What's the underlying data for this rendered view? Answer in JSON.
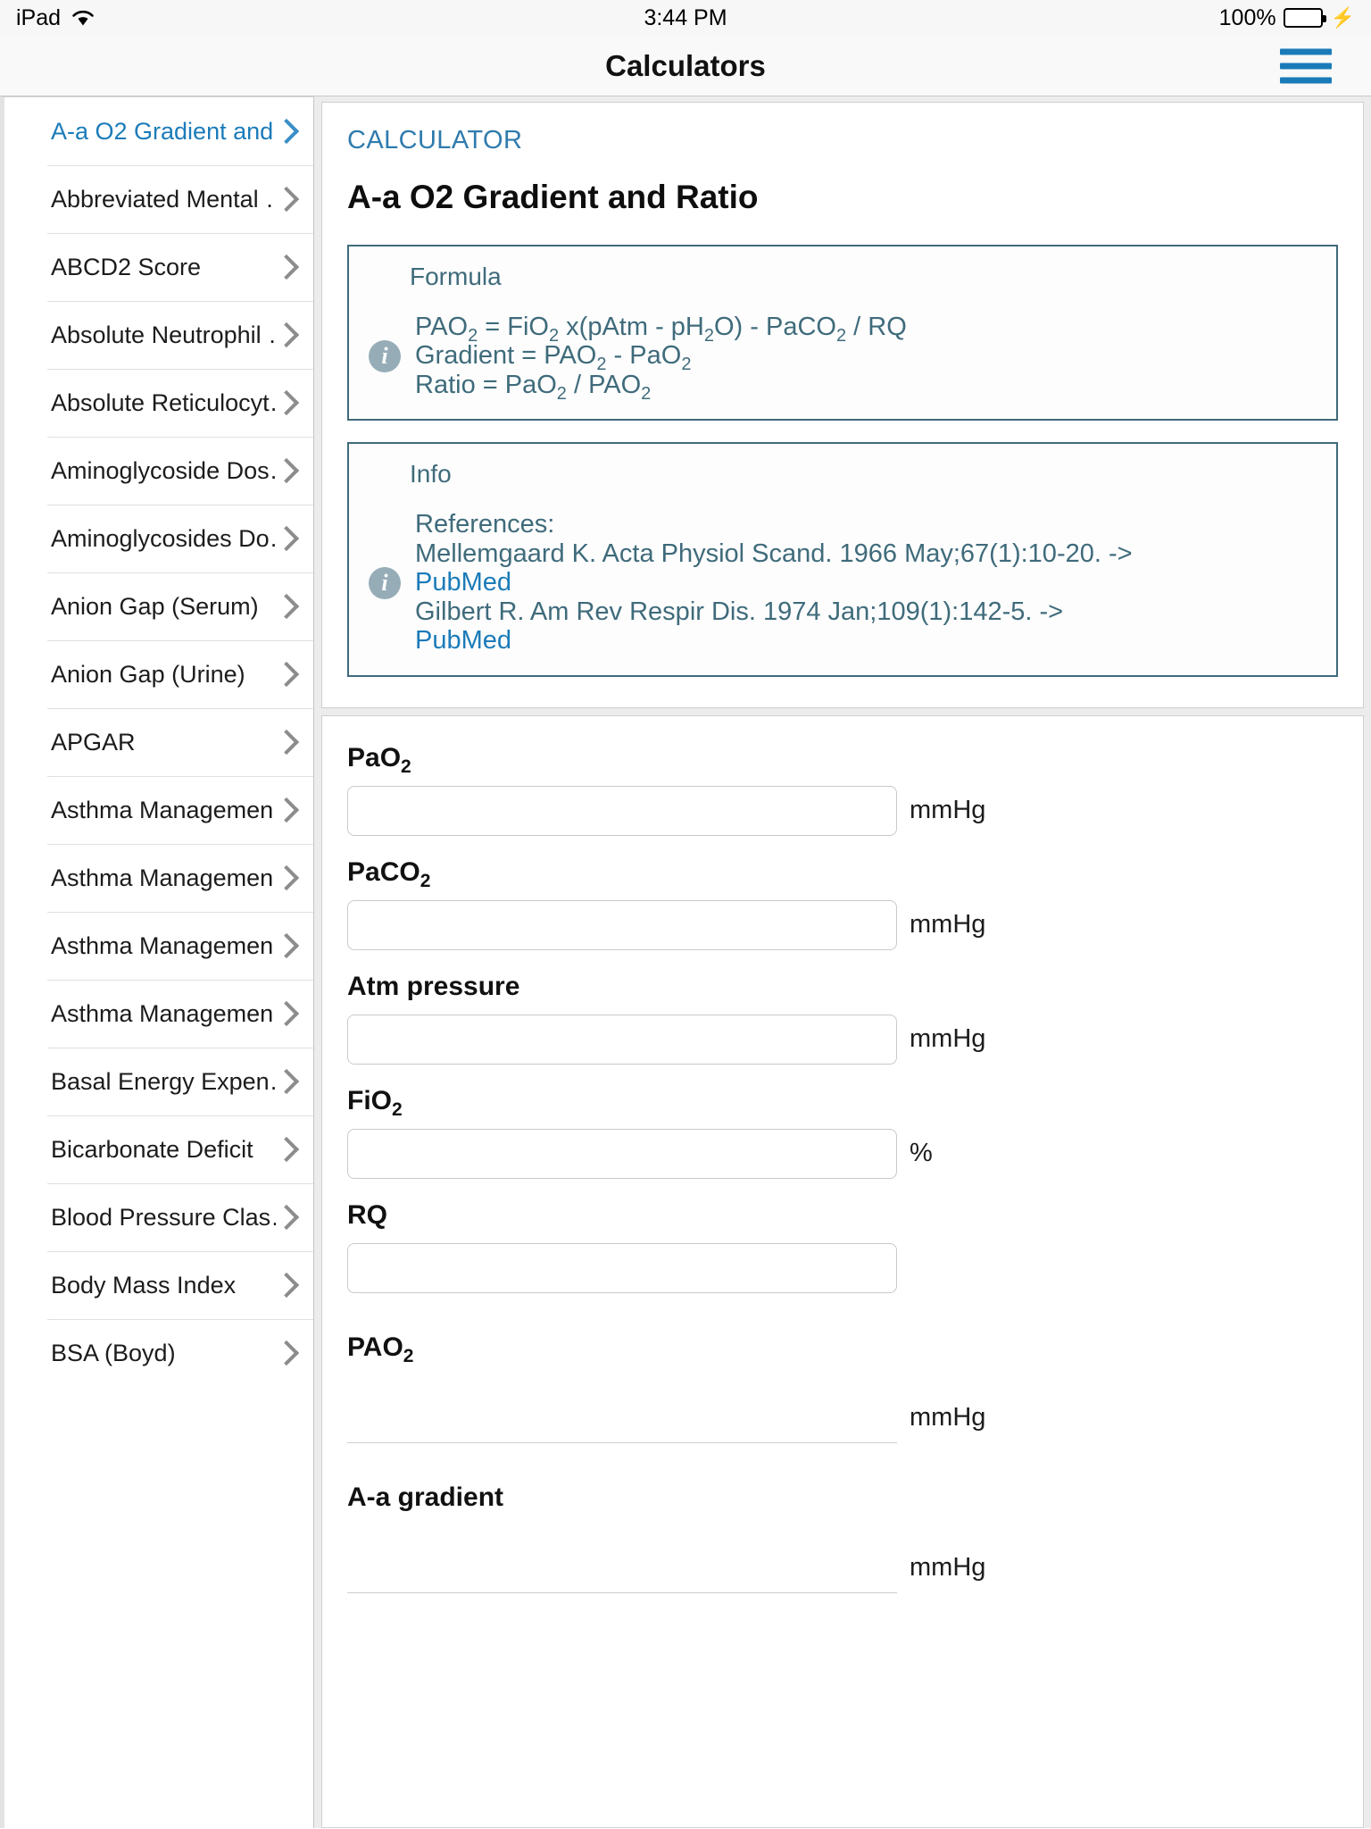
{
  "statusbar": {
    "device": "iPad",
    "wifi_icon": "wifi-icon",
    "time": "3:44 PM",
    "battery_percent": "100%",
    "battery_icon": "battery-full-icon",
    "charging_icon": "⚡"
  },
  "navbar": {
    "title": "Calculators",
    "menu_icon": "hamburger-menu-icon"
  },
  "sidebar": {
    "items": [
      {
        "label": "A-a O2 Gradient and…",
        "selected": true
      },
      {
        "label": "Abbreviated Mental …",
        "selected": false
      },
      {
        "label": "ABCD2 Score",
        "selected": false
      },
      {
        "label": "Absolute Neutrophil …",
        "selected": false
      },
      {
        "label": "Absolute Reticulocyt…",
        "selected": false
      },
      {
        "label": "Aminoglycoside Dos…",
        "selected": false
      },
      {
        "label": "Aminoglycosides Do…",
        "selected": false
      },
      {
        "label": "Anion Gap (Serum)",
        "selected": false
      },
      {
        "label": "Anion Gap (Urine)",
        "selected": false
      },
      {
        "label": "APGAR",
        "selected": false
      },
      {
        "label": "Asthma Managemen…",
        "selected": false
      },
      {
        "label": "Asthma Managemen…",
        "selected": false
      },
      {
        "label": "Asthma Managemen…",
        "selected": false
      },
      {
        "label": "Asthma Managemen…",
        "selected": false
      },
      {
        "label": "Basal Energy Expen…",
        "selected": false
      },
      {
        "label": "Bicarbonate Deficit",
        "selected": false
      },
      {
        "label": "Blood Pressure Clas…",
        "selected": false
      },
      {
        "label": "Body Mass Index",
        "selected": false
      },
      {
        "label": "BSA (Boyd)",
        "selected": false
      }
    ]
  },
  "detail": {
    "kicker": "CALCULATOR",
    "title": "A-a O2 Gradient and Ratio",
    "formula_box": {
      "heading": "Formula",
      "icon": "info-icon",
      "lines": [
        {
          "prefix": "PAO",
          "sub1": "2",
          "rest": " = FiO",
          "sub2": "2",
          "rest2": " x(pAtm - pH",
          "sub3": "2",
          "rest3": "O) - PaCO",
          "sub4": "2",
          "rest4": " / RQ",
          "plain": "PAO2 = FiO2 x(pAtm - pH2O) - PaCO2 / RQ"
        },
        {
          "plain": "Gradient = PAO2 - PaO2"
        },
        {
          "plain": "Ratio = PaO2 / PAO2"
        }
      ]
    },
    "info_box": {
      "heading": "Info",
      "icon": "info-icon",
      "lines": [
        {
          "text": "References:",
          "link": false
        },
        {
          "text": "Mellemgaard K. Acta Physiol Scand. 1966 May;67(1):10-20. ->",
          "link": false
        },
        {
          "text": "PubMed",
          "link": true
        },
        {
          "text": "Gilbert R. Am Rev Respir Dis. 1974 Jan;109(1):142-5. ->",
          "link": false
        },
        {
          "text": "PubMed",
          "link": true
        }
      ]
    }
  },
  "form": {
    "inputs": [
      {
        "label": "PaO",
        "sub": "2",
        "value": "",
        "placeholder": "",
        "unit": "mmHg",
        "readonly": false
      },
      {
        "label": "PaCO",
        "sub": "2",
        "value": "",
        "placeholder": "",
        "unit": "mmHg",
        "readonly": false
      },
      {
        "label": "Atm pressure",
        "sub": "",
        "value": "",
        "placeholder": "",
        "unit": "mmHg",
        "readonly": false
      },
      {
        "label": "FiO",
        "sub": "2",
        "value": "",
        "placeholder": "",
        "unit": "%",
        "readonly": false
      },
      {
        "label": "RQ",
        "sub": "",
        "value": "",
        "placeholder": "",
        "unit": "",
        "readonly": false
      }
    ],
    "results": [
      {
        "label": "PAO",
        "sub": "2",
        "value": "",
        "unit": "mmHg",
        "readonly": true
      },
      {
        "label": "A-a gradient",
        "sub": "",
        "value": "",
        "unit": "mmHg",
        "readonly": true
      }
    ]
  }
}
